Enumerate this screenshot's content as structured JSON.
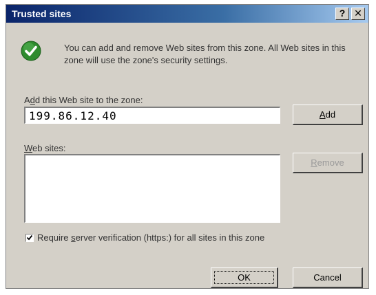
{
  "window": {
    "title": "Trusted sites",
    "help_glyph": "?",
    "close_glyph": "✕"
  },
  "info": {
    "icon": "check-circle-icon",
    "text": "You can add and remove Web sites from this zone. All Web sites in this zone will use the zone's security settings."
  },
  "add_site": {
    "label_pre": "A",
    "label_mn": "d",
    "label_post": "d this Web site to the zone:",
    "value": "199.86.12.40",
    "add_button": {
      "mn": "A",
      "rest": "dd"
    }
  },
  "web_sites": {
    "label_mn": "W",
    "label_post": "eb sites:",
    "items": [],
    "remove_button": {
      "mn": "R",
      "rest": "emove"
    }
  },
  "verification": {
    "checked": true,
    "label_pre": "Require ",
    "label_mn": "s",
    "label_post": "erver verification (https:) for all sites in this zone"
  },
  "footer": {
    "ok_label": "OK",
    "cancel_label": "Cancel"
  },
  "colors": {
    "title_start": "#0a246a",
    "title_end": "#a6caf0",
    "face": "#d4d0c8",
    "check_green": "#2e8b2e"
  }
}
